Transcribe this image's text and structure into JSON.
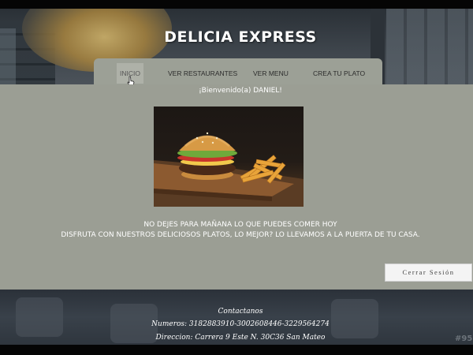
{
  "header": {
    "brand": "DELICIA EXPRESS"
  },
  "nav": {
    "items": [
      {
        "label": "INICIO",
        "active": true
      },
      {
        "label": "VER RESTAURANTES"
      },
      {
        "label": "VER MENU"
      },
      {
        "label": "CREA TU PLATO"
      }
    ]
  },
  "main": {
    "welcome": "¡Bienvenido(a) DANIEL!",
    "image_subject": "burger-and-fries",
    "promo_line1": "NO DEJES PARA MAÑANA LO QUE PUEDES COMER HOY",
    "promo_line2": "DISFRUTA CON NUESTROS DELICIOSOS PLATOS, LO MEJOR? LO LLEVAMOS A LA PUERTA DE TU CASA.",
    "logout_label": "Cerrar Sesión"
  },
  "footer": {
    "contact_title": "Contactanos",
    "phones": "Numeros: 3182883910-3002608446-3229564274",
    "address": "Direccion: Carrera 9 Este N. 30C36 San Mateo"
  },
  "watermark": "#95",
  "colors": {
    "panel": "#9b9e94",
    "nav": "#9ca096",
    "nav_active": "#aeb1a8",
    "button_bg": "#f4f4f4"
  }
}
